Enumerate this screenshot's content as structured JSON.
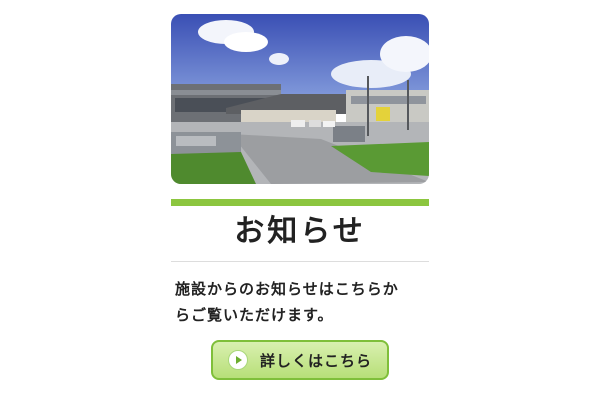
{
  "notice": {
    "photo_alt": "施設",
    "title": "お知らせ",
    "body_line1": "施設からのお知らせはこちらか",
    "body_line2": "らご覧いただけます。",
    "button_label": "詳しくはこちら"
  },
  "colors": {
    "accent_green": "#8cc63f",
    "button_border": "#7fbf3a"
  },
  "icons": {
    "button_icon": "play-icon"
  }
}
